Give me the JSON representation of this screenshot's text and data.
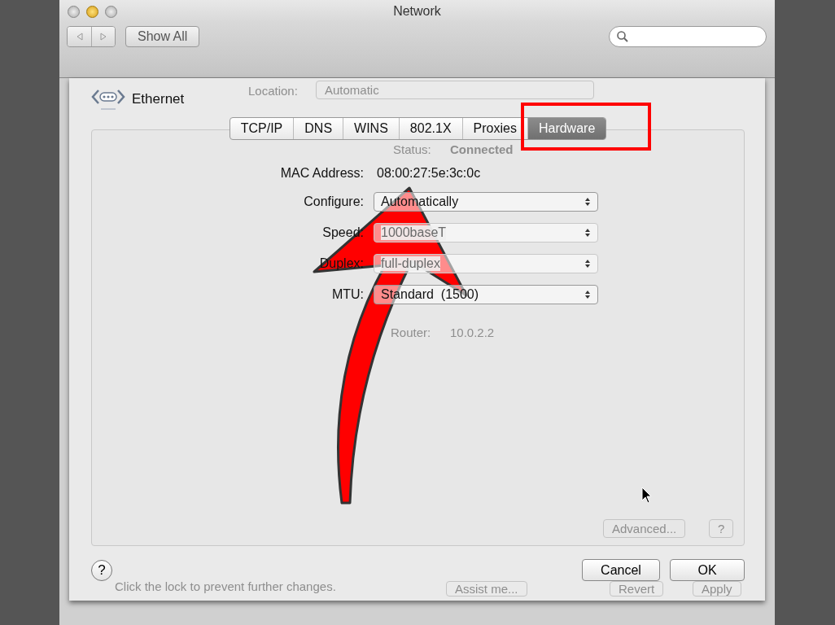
{
  "window": {
    "title": "Network"
  },
  "toolbar": {
    "show_all": "Show All"
  },
  "service": {
    "name": "Ethernet"
  },
  "background": {
    "location_label": "Location:",
    "location_value": "Automatic",
    "status_label": "Status:",
    "status_value": "Connected",
    "router_label": "Router:",
    "router_value": "10.0.2.2",
    "advanced": "Advanced...",
    "help": "?",
    "lock_text": "Click the lock to prevent further changes.",
    "assist": "Assist me...",
    "revert": "Revert",
    "apply": "Apply"
  },
  "tabs": [
    {
      "label": "TCP/IP",
      "selected": false
    },
    {
      "label": "DNS",
      "selected": false
    },
    {
      "label": "WINS",
      "selected": false
    },
    {
      "label": "802.1X",
      "selected": false
    },
    {
      "label": "Proxies",
      "selected": false
    },
    {
      "label": "Hardware",
      "selected": true
    }
  ],
  "rows": [
    {
      "kind": "text",
      "label": "MAC Address:",
      "value": "08:00:27:5e:3c:0c"
    },
    {
      "kind": "popup",
      "label": "Configure:",
      "value": "Automatically",
      "disabled": false
    },
    {
      "kind": "popup",
      "label": "Speed:",
      "value": "1000baseT",
      "disabled": true
    },
    {
      "kind": "popup",
      "label": "Duplex:",
      "value": "full-duplex",
      "disabled": true
    },
    {
      "kind": "popup",
      "label": "MTU:",
      "value": "Standard  (1500)",
      "disabled": false
    }
  ],
  "help": "?",
  "buttons": [
    "Cancel",
    "OK"
  ]
}
